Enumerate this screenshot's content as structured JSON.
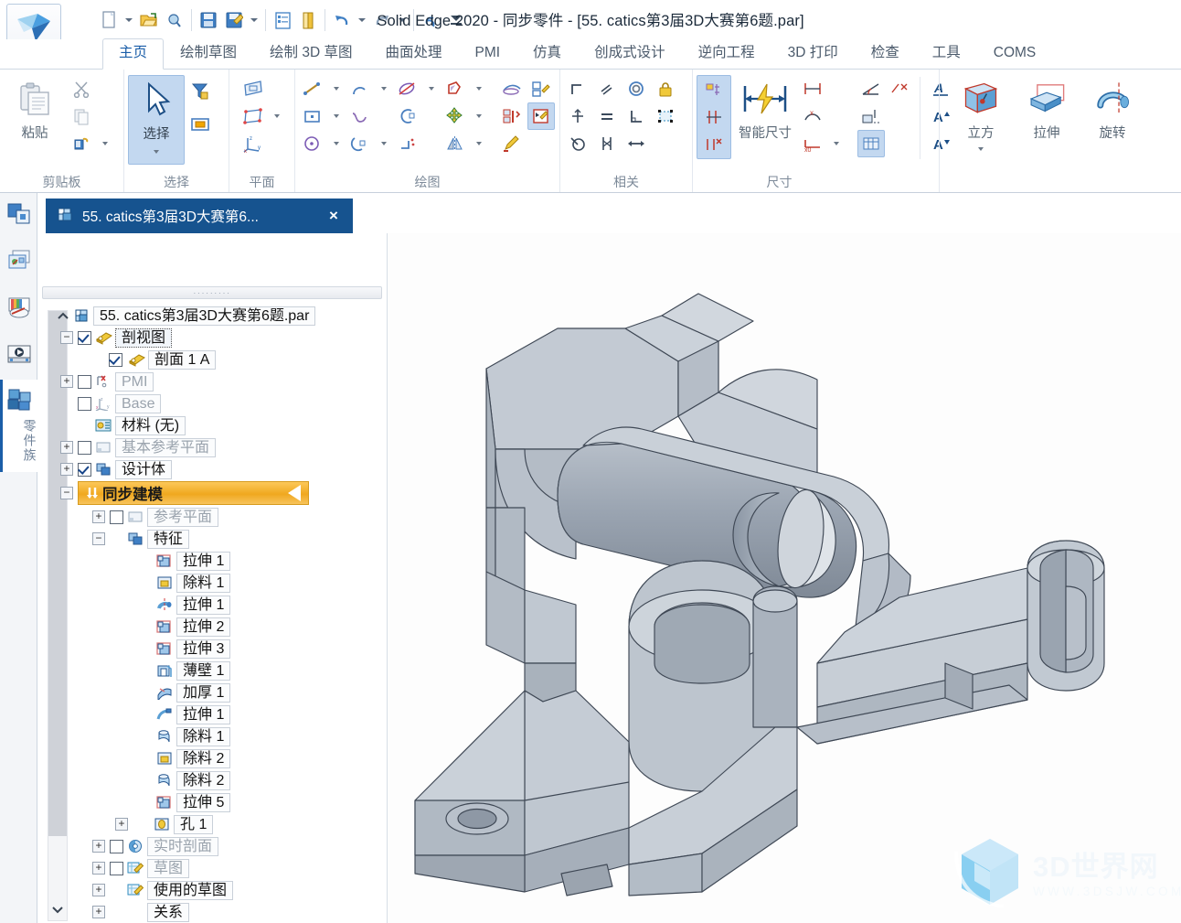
{
  "window": {
    "title": "Solid Edge 2020 - 同步零件 - [55. catics第3届3D大赛第6题.par]",
    "app_icon": "solid-edge-logo-icon"
  },
  "quick_access": {
    "items": [
      {
        "name": "new-document-icon",
        "label": "新建"
      },
      {
        "name": "new-dropdown-caret",
        "label": ""
      },
      {
        "name": "open-document-icon",
        "label": "打开"
      },
      {
        "name": "open-recent-icon",
        "label": "最近"
      },
      {
        "name": "save-icon",
        "label": "保存"
      },
      {
        "name": "save-as-icon",
        "label": "另存为"
      },
      {
        "name": "save-dropdown-caret",
        "label": ""
      },
      {
        "name": "properties-icon",
        "label": "属性"
      },
      {
        "name": "print-icon",
        "label": "打印"
      },
      {
        "name": "undo-icon",
        "label": "撤消"
      },
      {
        "name": "undo-dropdown-caret",
        "label": ""
      },
      {
        "name": "redo-icon",
        "label": "重做"
      },
      {
        "name": "redo-dropdown-caret",
        "label": ""
      },
      {
        "name": "repeat-icon",
        "label": "重复"
      },
      {
        "name": "customize-qat-caret",
        "label": "自定义"
      }
    ]
  },
  "ribbon": {
    "tabs": [
      {
        "label": "主页",
        "active": true
      },
      {
        "label": "绘制草图",
        "active": false
      },
      {
        "label": "绘制 3D 草图",
        "active": false
      },
      {
        "label": "曲面处理",
        "active": false
      },
      {
        "label": "PMI",
        "active": false
      },
      {
        "label": "仿真",
        "active": false
      },
      {
        "label": "创成式设计",
        "active": false
      },
      {
        "label": "逆向工程",
        "active": false
      },
      {
        "label": "3D 打印",
        "active": false
      },
      {
        "label": "检查",
        "active": false
      },
      {
        "label": "工具",
        "active": false
      },
      {
        "label": "COMS",
        "active": false
      }
    ],
    "groups": [
      {
        "label": "剪贴板",
        "name": "group-clipboard",
        "big": {
          "label": "粘贴",
          "icon": "paste-icon"
        },
        "small": [
          {
            "icon": "cut-icon"
          },
          {
            "icon": "copy-icon"
          },
          {
            "icon": "paint-format-icon"
          }
        ]
      },
      {
        "label": "选择",
        "name": "group-select",
        "big": {
          "label": "选择",
          "icon": "select-arrow-icon"
        },
        "small": [
          {
            "icon": "select-filter-icon"
          },
          {
            "icon": "select-region-icon"
          }
        ]
      },
      {
        "label": "平面",
        "name": "group-plane",
        "small": [
          {
            "icon": "sketch-plane-icon"
          },
          {
            "icon": "coincident-plane-icon"
          },
          {
            "icon": "coordinate-system-icon"
          }
        ]
      },
      {
        "label": "绘图",
        "name": "group-draw",
        "small": [
          {
            "icon": "line-icon"
          },
          {
            "icon": "rectangle-icon"
          },
          {
            "icon": "circle-icon"
          },
          {
            "icon": "arc-icon"
          },
          {
            "icon": "curve-icon"
          },
          {
            "icon": "arc-tangent-icon"
          },
          {
            "icon": "ellipse-crossed-icon"
          },
          {
            "icon": "fillet-icon"
          },
          {
            "icon": "trim-icon"
          },
          {
            "icon": "polygon-icon"
          },
          {
            "icon": "move-icon"
          },
          {
            "icon": "mirror-icon"
          }
        ],
        "extra": [
          {
            "icon": "project-curve-icon"
          },
          {
            "icon": "edit-profile-icon"
          },
          {
            "icon": "align-icon"
          },
          {
            "icon": "sketch-edit-icon",
            "highlight": true
          },
          {
            "icon": "draw-edit-icon"
          }
        ]
      },
      {
        "label": "相关",
        "name": "group-relationships",
        "small": [
          {
            "icon": "connect-icon"
          },
          {
            "icon": "parallel-icon"
          },
          {
            "icon": "concentric-icon"
          },
          {
            "icon": "lock-icon"
          },
          {
            "icon": "horizontal-vertical-icon"
          },
          {
            "icon": "equal-icon"
          },
          {
            "icon": "perpendicular-icon"
          },
          {
            "icon": "relationship-handles-icon"
          },
          {
            "icon": "tangent-icon"
          },
          {
            "icon": "symmetric-icon"
          },
          {
            "icon": "collinear-icon"
          }
        ]
      },
      {
        "label": "尺寸",
        "name": "group-dimension",
        "locked": [
          {
            "icon": "lock-dimension-icon"
          },
          {
            "icon": "dimension-axis-icon"
          },
          {
            "icon": "delete-dimension-icon"
          }
        ],
        "big": {
          "label": "智能尺寸",
          "icon": "smart-dimension-icon"
        },
        "small": [
          {
            "icon": "distance-between-icon"
          },
          {
            "icon": "angle-between-icon"
          },
          {
            "icon": "coordinate-dimension-icon"
          },
          {
            "icon": "symmetric-diameter-icon"
          },
          {
            "icon": "dim-align-icon"
          },
          {
            "icon": "dimension-table-icon",
            "highlight": true
          }
        ],
        "text_tools": [
          {
            "icon": "font-style-icon"
          },
          {
            "icon": "font-increase-icon"
          },
          {
            "icon": "font-decrease-icon"
          }
        ]
      },
      {
        "label": "",
        "name": "group-solids",
        "buttons": [
          {
            "label": "立方",
            "icon": "box-icon",
            "dropdown": true
          },
          {
            "label": "拉伸",
            "icon": "extrude-icon",
            "dropdown": false
          },
          {
            "label": "旋转",
            "icon": "revolve-icon",
            "dropdown": false
          }
        ]
      }
    ]
  },
  "rail": {
    "items": [
      {
        "name": "sidebar-item-pathfinder",
        "icon": "pathfinder-icon",
        "active": false
      },
      {
        "name": "sidebar-item-layers",
        "icon": "layers-icon",
        "active": false
      },
      {
        "name": "sidebar-item-appearance",
        "icon": "appearance-icon",
        "active": false
      },
      {
        "name": "sidebar-item-animation",
        "icon": "animation-icon",
        "active": false
      },
      {
        "name": "sidebar-item-family-of-parts",
        "icon": "family-of-parts-icon",
        "active": true,
        "label": "零件族"
      }
    ]
  },
  "doc_tab": {
    "label": "55. catics第3届3D大赛第6...",
    "icon": "part-document-icon",
    "close": "×"
  },
  "tree": {
    "root": {
      "label": "55. catics第3届3D大赛第6题.par",
      "icon": "part-document-icon",
      "expander": "^"
    },
    "items": [
      {
        "label": "剖视图",
        "icon": "section-view-icon",
        "indent": 1,
        "expander": "−",
        "checkbox": "checked",
        "style": "selected"
      },
      {
        "label": "剖面 1 A",
        "icon": "section-plane-icon",
        "indent": 2,
        "expander": "",
        "checkbox": "checked",
        "style": "normal"
      },
      {
        "label": "PMI",
        "icon": "pmi-icon",
        "indent": 1,
        "expander": "+",
        "checkbox": "unchecked",
        "style": "dim"
      },
      {
        "label": "Base",
        "icon": "base-coordinate-icon",
        "indent": 1,
        "expander": "",
        "checkbox": "unchecked",
        "style": "dim"
      },
      {
        "label": "材料 (无)",
        "icon": "material-icon",
        "indent": 1,
        "expander": "",
        "checkbox": "none",
        "style": "normal"
      },
      {
        "label": "基本参考平面",
        "icon": "reference-plane-icon",
        "indent": 1,
        "expander": "+",
        "checkbox": "unchecked",
        "style": "dim"
      },
      {
        "label": "设计体",
        "icon": "design-body-icon",
        "indent": 1,
        "expander": "+",
        "checkbox": "checked",
        "style": "normal"
      },
      {
        "label": "同步建模",
        "icon": "synchronous-icon",
        "indent": 1,
        "expander": "−",
        "checkbox": "none",
        "style": "highlight"
      },
      {
        "label": "参考平面",
        "icon": "reference-plane-icon",
        "indent": 2,
        "expander": "+",
        "checkbox": "unchecked",
        "style": "dim"
      },
      {
        "label": "特征",
        "icon": "features-folder-icon",
        "indent": 2,
        "expander": "−",
        "checkbox": "none",
        "style": "normal"
      },
      {
        "label": "拉伸 1",
        "icon": "extrude-feature-icon",
        "indent": 3,
        "expander": "",
        "checkbox": "none",
        "style": "normal"
      },
      {
        "label": "除料 1",
        "icon": "cutout-feature-icon",
        "indent": 3,
        "expander": "",
        "checkbox": "none",
        "style": "normal"
      },
      {
        "label": "拉伸 1",
        "icon": "revolve-feature-icon",
        "indent": 3,
        "expander": "",
        "checkbox": "none",
        "style": "normal"
      },
      {
        "label": "拉伸 2",
        "icon": "extrude-feature-icon",
        "indent": 3,
        "expander": "",
        "checkbox": "none",
        "style": "normal"
      },
      {
        "label": "拉伸 3",
        "icon": "extrude-feature-icon",
        "indent": 3,
        "expander": "",
        "checkbox": "none",
        "style": "normal"
      },
      {
        "label": "薄壁 1",
        "icon": "thin-wall-feature-icon",
        "indent": 3,
        "expander": "",
        "checkbox": "none",
        "style": "normal"
      },
      {
        "label": "加厚 1",
        "icon": "thicken-feature-icon",
        "indent": 3,
        "expander": "",
        "checkbox": "none",
        "style": "normal"
      },
      {
        "label": "拉伸 1",
        "icon": "sweep-feature-icon",
        "indent": 3,
        "expander": "",
        "checkbox": "none",
        "style": "normal"
      },
      {
        "label": "除料 1",
        "icon": "round-cutout-feature-icon",
        "indent": 3,
        "expander": "",
        "checkbox": "none",
        "style": "normal"
      },
      {
        "label": "除料 2",
        "icon": "cutout-feature-icon",
        "indent": 3,
        "expander": "",
        "checkbox": "none",
        "style": "normal"
      },
      {
        "label": "除料 2",
        "icon": "round-cutout-feature-icon",
        "indent": 3,
        "expander": "",
        "checkbox": "none",
        "style": "normal"
      },
      {
        "label": "拉伸 5",
        "icon": "extrude-feature-icon",
        "indent": 3,
        "expander": "",
        "checkbox": "none",
        "style": "normal"
      },
      {
        "label": "孔 1",
        "icon": "hole-feature-icon",
        "indent": 3,
        "expander": "+",
        "checkbox": "none",
        "style": "normal"
      },
      {
        "label": "实时剖面",
        "icon": "live-section-icon",
        "indent": 2,
        "expander": "+",
        "checkbox": "unchecked",
        "style": "dim"
      },
      {
        "label": "草图",
        "icon": "sketch-icon",
        "indent": 2,
        "expander": "+",
        "checkbox": "unchecked",
        "style": "dim"
      },
      {
        "label": "使用的草图",
        "icon": "sketch-icon",
        "indent": 2,
        "expander": "+",
        "checkbox": "none",
        "style": "normal"
      },
      {
        "label": "关系",
        "icon": "",
        "indent": 2,
        "expander": "+",
        "checkbox": "none",
        "style": "normal"
      }
    ]
  },
  "viewport": {
    "name": "3d-model-viewport",
    "watermark": {
      "main": "3D世界网",
      "sub": "WWW.3DSJW.COM",
      "logo": "hexagon-cube-logo-icon"
    }
  },
  "colors": {
    "accent": "#1b5ea8",
    "doc_tab": "#16538f",
    "highlight_row": "#f0a81f",
    "ribbon_selected": "#c3d8f0",
    "model_light": "#c2c9d2",
    "model_mid": "#9aa3b0",
    "model_dark": "#7d8695"
  }
}
